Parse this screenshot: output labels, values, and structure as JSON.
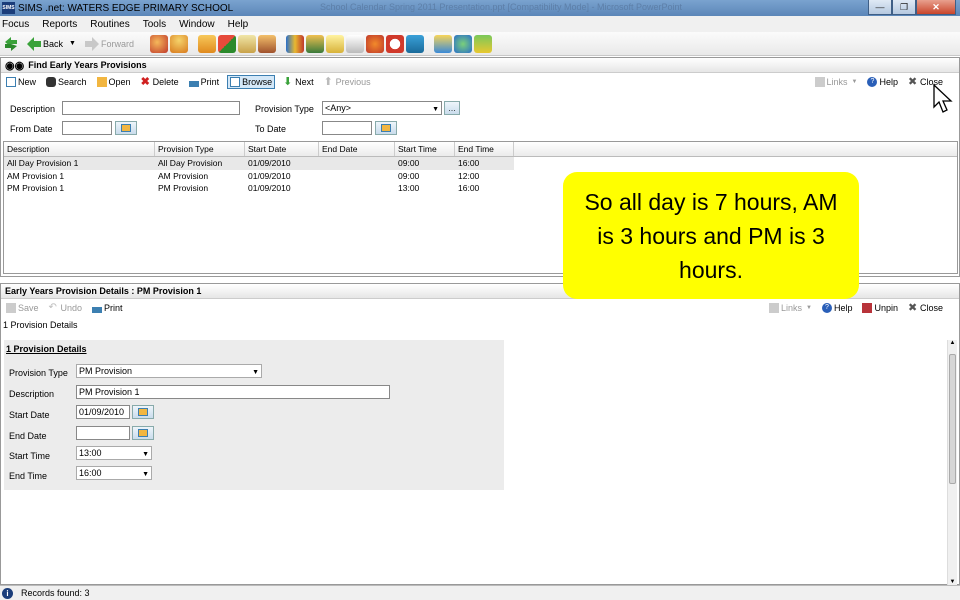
{
  "window": {
    "title": "SIMS .net: WATERS EDGE PRIMARY SCHOOL",
    "title_faded": "School Calendar Spring 2011 Presentation.ppt [Compatibility Mode] - Microsoft PowerPoint",
    "app_badge": "SIMS"
  },
  "menu": [
    "Focus",
    "Reports",
    "Routines",
    "Tools",
    "Window",
    "Help"
  ],
  "main_toolbar": {
    "back": "Back",
    "forward": "Forward"
  },
  "find_panel": {
    "title": "Find Early Years Provisions",
    "commands": {
      "new": "New",
      "search": "Search",
      "open": "Open",
      "delete": "Delete",
      "print": "Print",
      "browse": "Browse",
      "next": "Next",
      "previous": "Previous"
    },
    "right": {
      "links": "Links",
      "help": "Help",
      "close": "Close"
    },
    "filters": {
      "description_label": "Description",
      "description_value": "",
      "provision_type_label": "Provision Type",
      "provision_type_value": "<Any>",
      "from_date_label": "From Date",
      "to_date_label": "To Date"
    },
    "columns": [
      "Description",
      "Provision Type",
      "Start Date",
      "End Date",
      "Start Time",
      "End Time"
    ],
    "rows": [
      [
        "All Day Provision 1",
        "All Day Provision",
        "01/09/2010",
        "",
        "09:00",
        "16:00"
      ],
      [
        "AM Provision 1",
        "AM Provision",
        "01/09/2010",
        "",
        "09:00",
        "12:00"
      ],
      [
        "PM Provision 1",
        "PM Provision",
        "01/09/2010",
        "",
        "13:00",
        "16:00"
      ]
    ]
  },
  "details_panel": {
    "title": "Early Years Provision Details : PM Provision 1",
    "commands": {
      "save": "Save",
      "undo": "Undo",
      "print": "Print"
    },
    "right": {
      "links": "Links",
      "help": "Help",
      "unpin": "Unpin",
      "close": "Close"
    },
    "nav_link": "1 Provision Details",
    "section_title": "1 Provision Details",
    "fields": {
      "provision_type_label": "Provision Type",
      "provision_type_value": "PM Provision",
      "description_label": "Description",
      "description_value": "PM Provision 1",
      "start_date_label": "Start Date",
      "start_date_value": "01/09/2010",
      "end_date_label": "End Date",
      "end_date_value": "",
      "start_time_label": "Start Time",
      "start_time_value": "13:00",
      "end_time_label": "End Time",
      "end_time_value": "16:00"
    }
  },
  "status": {
    "records_found": "Records found: 3"
  },
  "callout": "So all day is 7 hours, AM is 3 hours and PM is 3 hours.",
  "colors": {
    "callout": "#ffff00",
    "titlebar": "#6b95c4",
    "accent": "#3c7fb1"
  }
}
